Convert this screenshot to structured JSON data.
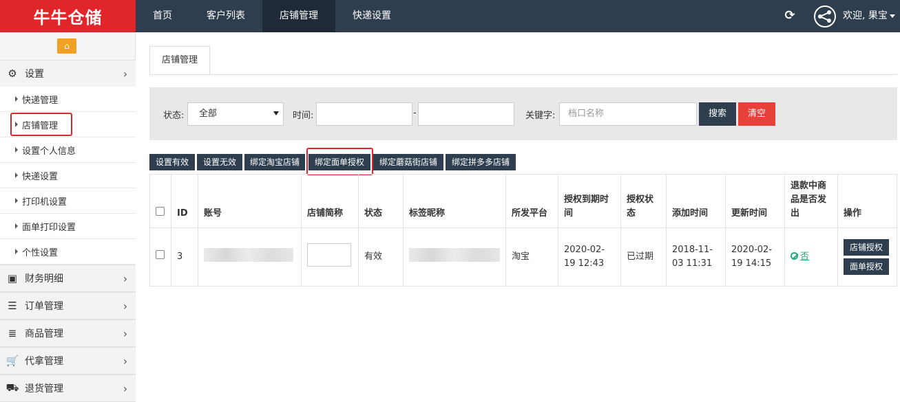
{
  "brand": {
    "logo_text": "牛牛仓储"
  },
  "topnav": {
    "items": [
      {
        "label": "首页"
      },
      {
        "label": "客户列表"
      },
      {
        "label": "店铺管理"
      },
      {
        "label": "快递设置"
      }
    ],
    "active": "店铺管理",
    "refresh_icon": "refresh-icon",
    "user_greeting": "欢迎, 果宝"
  },
  "sidebar": {
    "home_icon": "home-icon",
    "groups": [
      {
        "label": "设置",
        "icon": "gears-icon"
      },
      {
        "label": "财务明细",
        "icon": "briefcase-icon"
      },
      {
        "label": "订单管理",
        "icon": "bars-icon"
      },
      {
        "label": "商品管理",
        "icon": "list-icon"
      },
      {
        "label": "代拿管理",
        "icon": "cart-icon"
      },
      {
        "label": "退货管理",
        "icon": "truck-icon"
      }
    ],
    "settings_items": [
      {
        "label": "快递管理"
      },
      {
        "label": "店铺管理"
      },
      {
        "label": "设置个人信息"
      },
      {
        "label": "快递设置"
      },
      {
        "label": "打印机设置"
      },
      {
        "label": "面单打印设置"
      },
      {
        "label": "个性设置"
      }
    ],
    "highlighted_item": "店铺管理"
  },
  "tab": {
    "label": "店铺管理"
  },
  "filter": {
    "status_label": "状态:",
    "status_value": "全部",
    "time_label": "时间:",
    "time_separator": "-",
    "keyword_label": "关键字:",
    "keyword_placeholder": "档口名称",
    "search_button": "搜索",
    "clear_button": "清空"
  },
  "actions": [
    {
      "label": "设置有效"
    },
    {
      "label": "设置无效"
    },
    {
      "label": "绑定淘宝店铺"
    },
    {
      "label": "绑定面单授权"
    },
    {
      "label": "绑定蘑菇街店铺"
    },
    {
      "label": "绑定拼多多店铺"
    }
  ],
  "highlighted_action": "绑定面单授权",
  "table": {
    "headers": [
      "ID",
      "账号",
      "店铺简称",
      "状态",
      "标签昵称",
      "所发平台",
      "授权到期时间",
      "授权状态",
      "添加时间",
      "更新时间",
      "退款中商品是否发出",
      "操作"
    ],
    "rows": [
      {
        "id": "3",
        "status": "有效",
        "platform": "淘宝",
        "auth_expiry": "2020-02-19 12:43",
        "auth_status": "已过期",
        "added": "2018-11-03 11:31",
        "updated": "2020-02-19 14:15",
        "refund_shipped": "否",
        "op_shop_auth": "店铺授权",
        "op_waybill_auth": "面单授权"
      }
    ]
  },
  "colors": {
    "brand_red": "#e0262b",
    "nav_dark": "#2f3e4e",
    "home_orange": "#f0a022",
    "clear_red": "#e8413a",
    "link_green": "#2aa87c"
  }
}
